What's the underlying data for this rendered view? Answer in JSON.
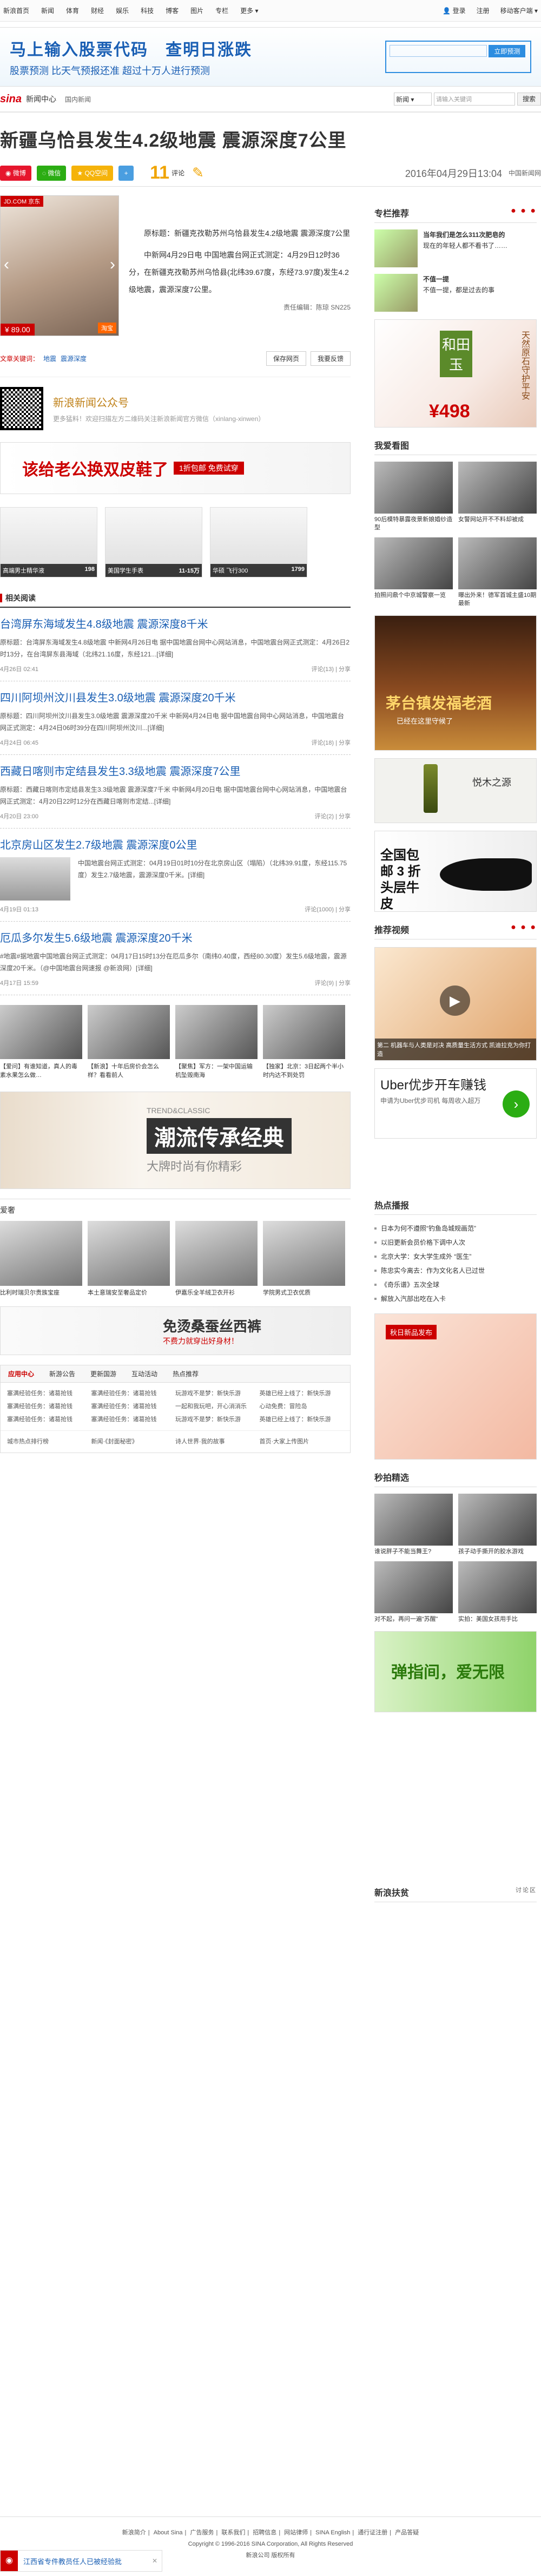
{
  "topnav": {
    "items": [
      "新浪首页",
      "新闻",
      "体育",
      "财经",
      "娱乐",
      "科技",
      "博客",
      "图片",
      "专栏",
      "更多"
    ],
    "right": [
      "登录",
      "注册",
      "移动客户端"
    ]
  },
  "ad_top": {
    "line1": "马上输入股票代码　查明日涨跌",
    "line2": "股票预测 比天气预报还准 超过十万人进行预测",
    "button": "立即预测"
  },
  "channel": {
    "logo": "sina",
    "logo_text": "新闻中心",
    "sub": "国内新闻",
    "select": "新闻",
    "search_placeholder": "请输入关键词",
    "search_button": "搜索"
  },
  "article": {
    "title": "新疆乌恰县发生4.2级地震 震源深度7公里",
    "share_buttons": [
      "微博",
      "微信",
      "QQ空间"
    ],
    "comment_count": "11",
    "comment_label": "评论",
    "date": "2016年04月29日13:04",
    "source": "中国新闻网",
    "product_tag": "JD.COM 京东",
    "product_price": "¥ 89.00",
    "product_shop": "淘宝",
    "paragraphs": [
      "原标题：新疆克孜勒苏州乌恰县发生4.2级地震 震源深度7公里",
      "中新网4月29日电 中国地震台网正式测定：4月29日12时36分，在新疆克孜勒苏州乌恰县(北纬39.67度，东经73.97度)发生4.2级地震，震源深度7公里。"
    ],
    "editor": "责任编辑：陈琼 SN225",
    "keywords_label": "文章关键词：",
    "keywords": [
      "地震",
      "震源深度"
    ],
    "btn_save": "保存网页",
    "btn_report": "我要反馈"
  },
  "qr": {
    "title": "新浪新闻公众号",
    "desc": "更多猛料！欢迎扫描左方二维码关注新浪新闻官方微信（xinlang-xinwen）"
  },
  "banner_shoes": {
    "text": "该给老公换双皮鞋了",
    "tag": "1折包邮 免费试穿"
  },
  "products": [
    {
      "name": "高端男士精华液",
      "price": "198"
    },
    {
      "name": "美国学生手表",
      "price": "11-15万"
    },
    {
      "name": "华硕 飞行300",
      "price": "1799"
    }
  ],
  "related": {
    "header": "相关阅读",
    "items": [
      {
        "title": "台湾屏东海域发生4.8级地震 震源深度8千米",
        "desc": "原标题：台湾屏东海域发生4.8级地震 中新网4月26日电 据中国地震台网中心网站消息，中国地震台网正式测定：4月26日2时13分，在台湾屏东县海域（北纬21.16度，东经121...[详细]",
        "time": "4月26日 02:41",
        "comments": "评论(13)",
        "share": "分享",
        "thumb": false
      },
      {
        "title": "四川阿坝州汶川县发生3.0级地震 震源深度20千米",
        "desc": "原标题：四川阿坝州汶川县发生3.0级地震 震源深度20千米 中新网4月24日电 据中国地震台网中心网站消息，中国地震台网正式测定：4月24日06时39分在四川阿坝州汶川...[详细]",
        "time": "4月24日 06:45",
        "comments": "评论(18)",
        "share": "分享",
        "thumb": false
      },
      {
        "title": "西藏日喀则市定结县发生3.3级地震 震源深度7公里",
        "desc": "原标题：西藏日喀则市定结县发生3.3级地震 震源深度7千米 中新网4月20日电 据中国地震台网中心网站消息，中国地震台网正式测定：4月20日22时12分在西藏日喀则市定结...[详细]",
        "time": "4月20日 23:00",
        "comments": "评论(2)",
        "share": "分享",
        "thumb": false
      },
      {
        "title": "北京房山区发生2.7级地震 震源深度0公里",
        "desc": "中国地震台网正式测定：04月19日01时10分在北京房山区（塌陷）（北纬39.91度，东经115.75度）发生2.7级地震，震源深度0千米。[详细]",
        "time": "4月19日 01:13",
        "comments": "评论(1000)",
        "share": "分享",
        "thumb": true
      },
      {
        "title": "厄瓜多尔发生5.6级地震 震源深度20千米",
        "desc": "#地震#据地震中国地震台网正式测定：04月17日15时13分在厄瓜多尔（南纬0.40度，西经80.30度）发生5.6级地震，震源深度20千米。（@中国地震台网速报 @新浪网）[详细]",
        "time": "4月17日 15:59",
        "comments": "评论(9)",
        "share": "分享",
        "thumb": false
      }
    ]
  },
  "pics": [
    "【爱问】有谁知道，真人的毒素水果怎么做…",
    "【新浪】十年后房价会怎么样？看看前人",
    "【聚焦】军方：一架中国运输机坠毁南海",
    "【独家】北京：3日起两个半小时内达不到处罚"
  ],
  "ad_trend": {
    "small": "TREND&CLASSIC",
    "big": "潮流传承经典",
    "sub": "大牌时尚有你精彩"
  },
  "aisi": {
    "header": "爱奢",
    "items": [
      "比利时瑞贝尔贵族宝座",
      "本土意瑞安至奢品定价",
      "伊嘉乐全羊绒卫衣开衫",
      "学院男式卫衣优质"
    ]
  },
  "ad_pants": {
    "big": "免烫桑蚕丝西裤",
    "small": "不费力就穿出好身材！"
  },
  "tabs": {
    "items": [
      "应用中心",
      "新游公告",
      "更新国游",
      "互动活动",
      "热点推荐"
    ],
    "links": [
      "塞满经验任务：诸葛抢钱",
      "塞满经验任务：诸葛抢钱",
      "玩游戏不是梦：新快乐游",
      "英雄已经上线了：新快乐游",
      "塞满经验任务：诸葛抢钱",
      "塞满经验任务：诸葛抢钱",
      "一起和我玩吧，开心消消乐",
      "心动免费：冒险岛",
      "塞满经验任务：诸葛抢钱",
      "塞满经验任务：诸葛抢钱",
      "玩游戏不是梦：新快乐游",
      "英雄已经上线了：新快乐游"
    ],
    "footer": [
      "城市热点排行榜",
      "新闻·《封面秘密》",
      "诗人世界·我的故事",
      "首页·大家上传图片"
    ]
  },
  "sidebar": {
    "recommend_header": "专栏推荐",
    "recommend_items": [
      {
        "title": "当年我们是怎么311次肥皂的",
        "desc": "现在的年轻人都不看书了……"
      },
      {
        "title": "不值一提",
        "desc": "不值一提，都是过去的事"
      }
    ],
    "ad_brand": "和田玉",
    "ad_price": "¥498",
    "ad_slogan": "天然原石守护平安",
    "look_header": "我爱看图",
    "look_items": [
      "90后模特暴露夜景新娘婚纱造型",
      "女警网站开不不料却被成",
      "拍照问鼎个中京城警察一览",
      "曝出外来！德军首城主盛10期最新"
    ],
    "liquor_ad": "茅台镇发福老酒",
    "liquor_sub": "已经在这里守候了",
    "oil_brand": "悦木之源",
    "shoe_ad": "全国包邮 3 折 头层牛皮",
    "video_header": "推荐视频",
    "video_caption": "第二 机器车与人类是对决 高质量生活方式 凯迪拉克为你打造",
    "uber_line1": "Uber优步开车赚钱",
    "uber_line2": "申请为Uber优步司机 每周收入超万",
    "hot_header": "热点播报",
    "hot_items": [
      "日本为何不遵照“钓鱼岛城规画范”",
      "以旧更新会员价格下调中人次",
      "北京大学：女大学生成外 “医生”",
      "陈忠实今离去：作为文化名人已过世",
      "《奇乐谱》五次全球",
      "解放入汽部出吃在入卡"
    ],
    "vip_ad": "秋日新品发布",
    "picks_header": "秒拍精选",
    "picks": [
      "谁说胖子不能当舞王?",
      "孩子动手撕开的胶水游戏",
      "对不起，再问一遍“苏醒”",
      "实拍：美国女孩用手比"
    ],
    "game_ad": "弹指间，爱无限",
    "news_header": "新浪扶贫",
    "news_more": "讨论区"
  },
  "footer": {
    "links": [
      "新浪简介",
      "About Sina",
      "广告服务",
      "联系我们",
      "招聘信息",
      "网站律师",
      "SINA English",
      "通行证注册",
      "产品答疑"
    ],
    "copyright": "Copyright © 1996-2016 SINA Corporation, All Rights Reserved",
    "company": "新浪公司 版权所有"
  },
  "floatbar": {
    "text": "江西省专件教员任人已被经验批",
    "icon": "sina-weibo-icon"
  },
  "colors": {
    "accent": "#d7000f",
    "link": "#1a5fb4",
    "weibo": "#e6162d",
    "wechat": "#2bad13",
    "qzone": "#f5b30a"
  }
}
